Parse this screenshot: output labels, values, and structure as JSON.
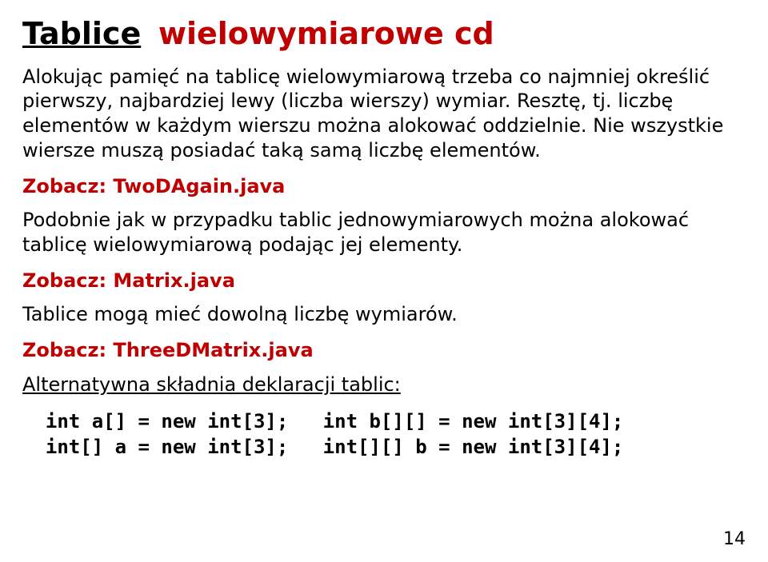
{
  "title": {
    "main": "Tablice",
    "sub": "wielowymiarowe cd"
  },
  "para1": "Alokując pamięć na tablicę wielowymiarową trzeba co najmniej określić pierwszy, najbardziej lewy (liczba wierszy) wymiar. Resztę, tj. liczbę elementów w każdym wierszu można alokować oddzielnie. Nie wszystkie wiersze muszą posiadać taką samą liczbę elementów.",
  "ref1_label": "Zobacz:",
  "ref1_file": "TwoDAgain.java",
  "para2": "Podobnie jak w przypadku tablic jednowymiarowych można alokować tablicę wielowymiarową podając jej elementy.",
  "ref2_label": "Zobacz:",
  "ref2_file": "Matrix.java",
  "para3": "Tablice mogą mieć dowolną liczbę wymiarów.",
  "ref3_label": "Zobacz:",
  "ref3_file": "ThreeDMatrix.java",
  "subhead": "Alternatywna składnia deklaracji tablic:",
  "code": "  int a[] = new int[3];   int b[][] = new int[3][4];\n  int[] a = new int[3];   int[][] b = new int[3][4];",
  "pagenum": "14"
}
